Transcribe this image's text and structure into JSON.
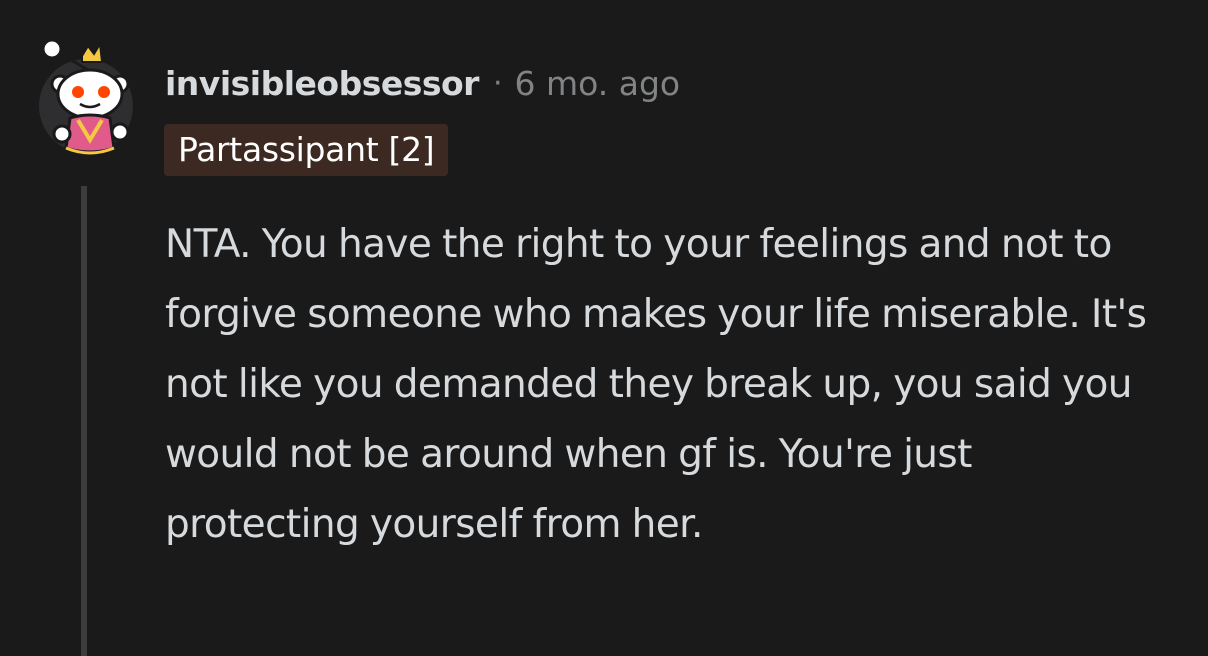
{
  "comment": {
    "author": "invisibleobsessor",
    "separator": "·",
    "timestamp": "6 mo. ago",
    "flair": "Partassipant [2]",
    "body": "NTA. You have the right to your feelings and not to forgive someone who makes your life miserable. It's not like you demanded they break up, you said you would not be around when gf is. You're just protecting yourself from her."
  },
  "colors": {
    "background": "#1a1a1b",
    "text": "#d7dadc",
    "meta_text": "#818384",
    "flair_bg": "#3c2a22",
    "flair_text": "#ffffff",
    "thread_line": "#3d3d3f"
  },
  "icons": {
    "avatar": "snoo-avatar-icon"
  }
}
